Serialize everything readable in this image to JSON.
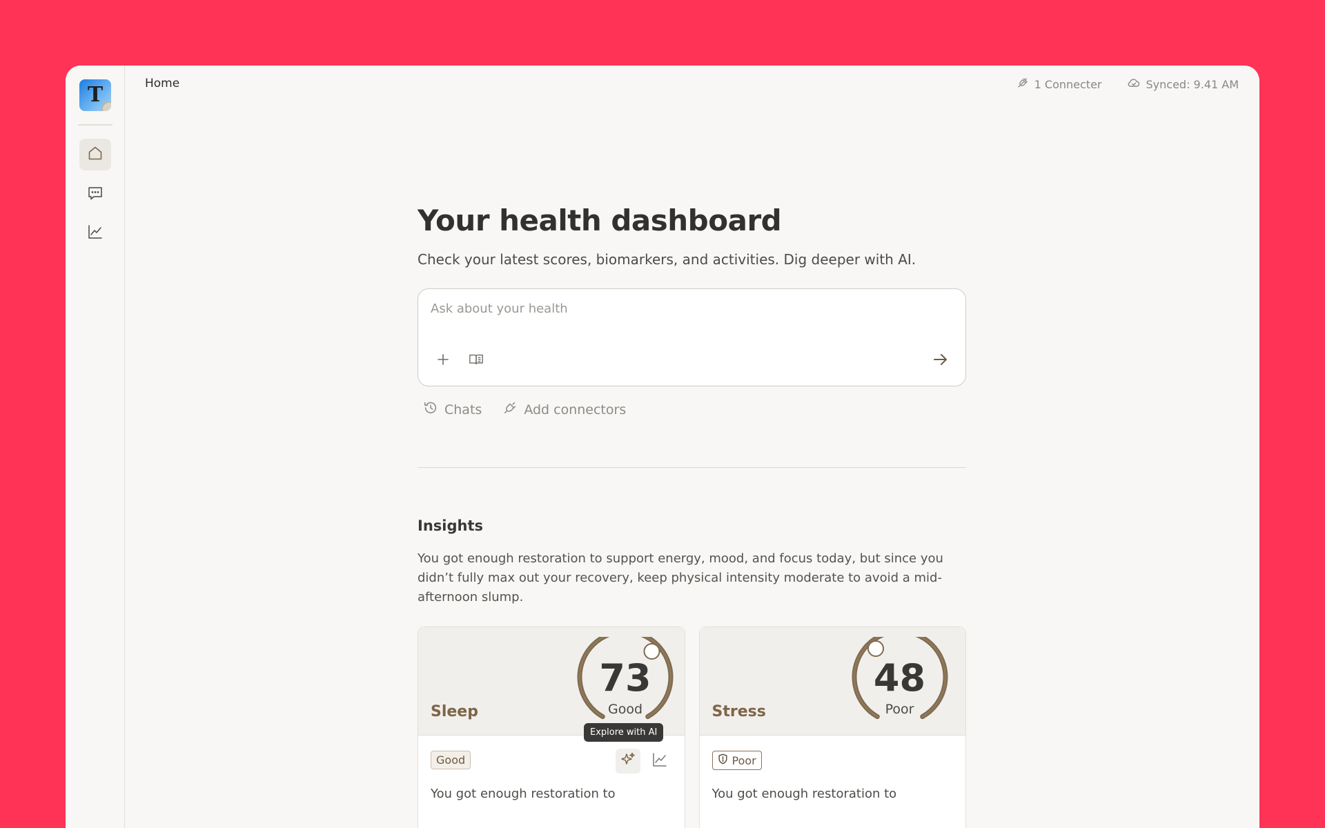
{
  "app": {
    "logo_letter": "T",
    "breadcrumb": "Home"
  },
  "sidebar": {
    "items": [
      {
        "icon": "home-icon",
        "active": true
      },
      {
        "icon": "chat-icon",
        "active": false
      },
      {
        "icon": "chart-icon",
        "active": false
      }
    ]
  },
  "topbar": {
    "connector_label": "1 Connecter",
    "sync_label": "Synced: 9.41 AM"
  },
  "main": {
    "title": "Your health dashboard",
    "subtitle": "Check your latest scores, biomarkers, and activities. Dig deeper with AI.",
    "ask_placeholder": "Ask about your health",
    "links": {
      "chats": "Chats",
      "add_connectors": "Add connectors"
    }
  },
  "insights": {
    "heading": "Insights",
    "text": "You got enough restoration to support energy, mood, and focus today, but since you didn’t fully max out your recovery, keep physical intensity moderate to avoid a mid-afternoon slump."
  },
  "cards": [
    {
      "label": "Sleep",
      "score": "73",
      "rating": "Good",
      "badge": "Good",
      "tooltip": "Explore with AI",
      "text": "You got enough restoration to"
    },
    {
      "label": "Stress",
      "score": "48",
      "rating": "Poor",
      "badge": "Poor",
      "text": "You got enough restoration to"
    }
  ],
  "colors": {
    "background": "#ff3355",
    "accent_brown": "#7d6548",
    "gauge_stroke": "#7f6a4f"
  }
}
